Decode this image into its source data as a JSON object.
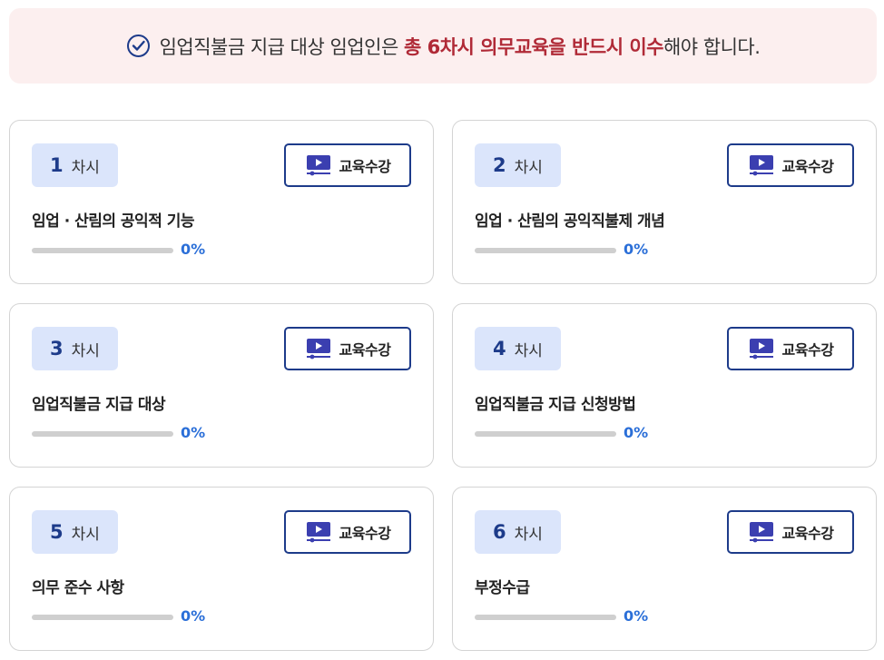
{
  "notice": {
    "text_before": "임업직불금 지급 대상 임업인은 ",
    "text_highlight": "총 6차시 의무교육을 반드시 이수",
    "text_after": "해야 합니다.",
    "icon": "check-circle-icon",
    "highlight_color": "#b02a37"
  },
  "lesson_unit": "차시",
  "button_label": "교육수강",
  "button_icon": "video-play-icon",
  "lessons": [
    {
      "num": "1",
      "title": "임업 · 산림의 공익적 기능",
      "progress": 0,
      "progress_label": "0%"
    },
    {
      "num": "2",
      "title": "임업 · 산림의 공익직불제 개념",
      "progress": 0,
      "progress_label": "0%"
    },
    {
      "num": "3",
      "title": "임업직불금 지급 대상",
      "progress": 0,
      "progress_label": "0%"
    },
    {
      "num": "4",
      "title": "임업직불금 지급 신청방법",
      "progress": 0,
      "progress_label": "0%"
    },
    {
      "num": "5",
      "title": "의무 준수 사항",
      "progress": 0,
      "progress_label": "0%"
    },
    {
      "num": "6",
      "title": "부정수급",
      "progress": 0,
      "progress_label": "0%"
    }
  ],
  "colors": {
    "accent": "#1d3b8a",
    "progress": "#2b6fd8",
    "badge_bg": "#dbe5fb",
    "notice_bg": "#fcefef"
  }
}
